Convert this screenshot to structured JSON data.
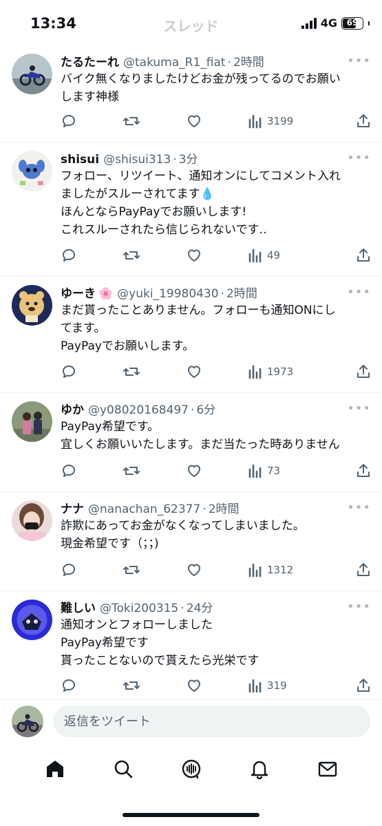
{
  "status_bar": {
    "time": "13:34",
    "network": "4G",
    "battery": "69",
    "battery_level": 0.69
  },
  "header": {
    "title": "スレッド"
  },
  "tweets": [
    {
      "name": "たるたーれ",
      "name_emoji": "",
      "handle": "@takuma_R1_fiat",
      "time": "2時間",
      "lines": [
        "バイク無くなりましたけどお金が残ってるのでお願い",
        "します神様"
      ],
      "views": "3199"
    },
    {
      "name": "shisui",
      "name_emoji": "",
      "handle": "@shisui313",
      "time": "3分",
      "lines": [
        "フォロー、リツイート、通知オンにしてコメント入れ",
        "ましたがスルーされてます💧",
        "ほんとならPayPayでお願いします!",
        "これスルーされたら信じられないです‥"
      ],
      "views": "49"
    },
    {
      "name": "ゆーき",
      "name_emoji": "🌸",
      "handle": "@yuki_19980430",
      "time": "2時間",
      "lines": [
        "まだ貰ったことありません。フォローも通知ONにし",
        "てます。",
        "PayPayでお願いします。"
      ],
      "views": "1973"
    },
    {
      "name": "ゆか",
      "name_emoji": "",
      "handle": "@y08020168497",
      "time": "6分",
      "lines": [
        "PayPay希望です。",
        "宜しくお願いいたします。まだ当たった時ありません"
      ],
      "views": "73"
    },
    {
      "name": "ナナ",
      "name_emoji": "",
      "handle": "@nanachan_62377",
      "time": "2時間",
      "lines": [
        "詐欺にあってお金がなくなってしまいました。",
        "現金希望です（；；)"
      ],
      "views": "1312"
    },
    {
      "name": "難しい",
      "name_emoji": "",
      "handle": "@Toki200315",
      "time": "24分",
      "lines": [
        "通知オンとフォローしました",
        "PayPay希望です",
        "貰ったことないので貰えたら光栄です"
      ],
      "views": "319"
    }
  ],
  "reply": {
    "placeholder": "返信をツイート"
  },
  "tab_bar": {
    "icons": [
      "home-icon",
      "search-icon",
      "spaces-icon",
      "notifications-icon",
      "messages-icon"
    ]
  },
  "colors": {
    "text": "#0f1419",
    "secondary": "#536471",
    "divider": "#eff3f4",
    "input_bg": "#eff3f4"
  }
}
